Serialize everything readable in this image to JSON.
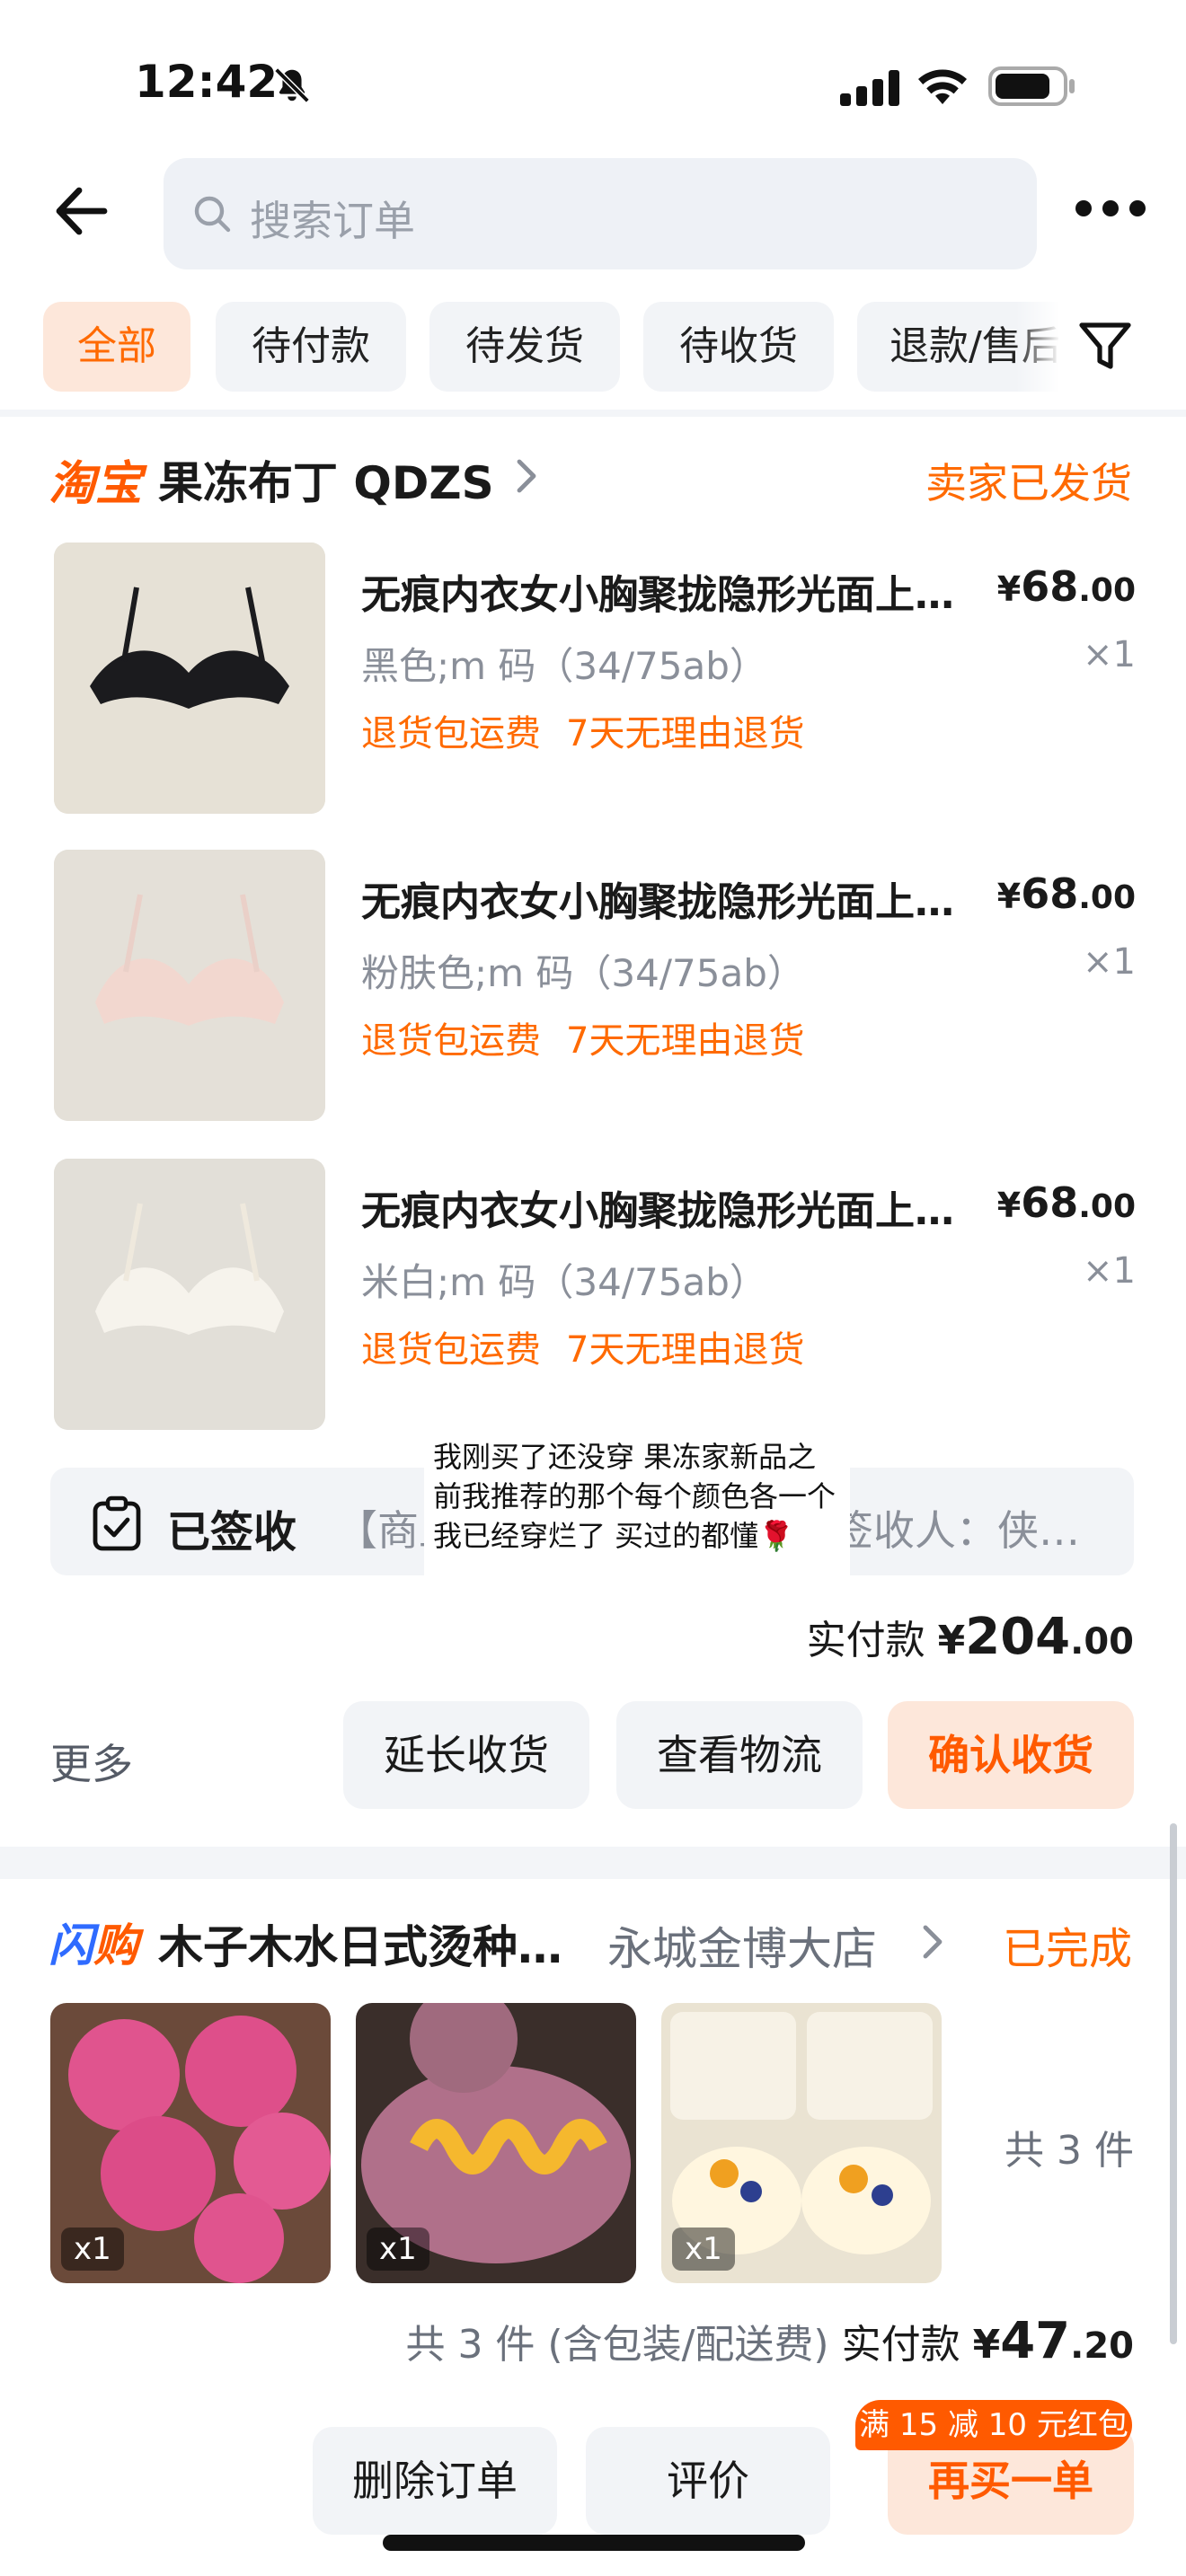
{
  "status_bar": {
    "time": "12:42"
  },
  "header": {
    "search_placeholder": "搜索订单"
  },
  "tabs": [
    {
      "label": "全部",
      "active": true
    },
    {
      "label": "待付款",
      "active": false
    },
    {
      "label": "待发货",
      "active": false
    },
    {
      "label": "待收货",
      "active": false
    },
    {
      "label": "退款/售后",
      "active": false
    }
  ],
  "order1": {
    "platform": "淘宝",
    "shop": "果冻布丁 QDZS",
    "status": "卖家已发货",
    "items": [
      {
        "title": "无痕内衣女小胸聚拢隐形光面上托文胸",
        "price_int": "68",
        "price_dec": ".00",
        "spec": "黑色;m 码（34/75ab）",
        "qty": "×1",
        "tags": [
          "退货包运费",
          "7天无理由退货"
        ],
        "color": "#1b1b1e"
      },
      {
        "title": "无痕内衣女小胸聚拢隐形光面上托文胸",
        "price_int": "68",
        "price_dec": ".00",
        "spec": "粉肤色;m 码（34/75ab）",
        "qty": "×1",
        "tags": [
          "退货包运费",
          "7天无理由退货"
        ],
        "color": "#f2d7cf"
      },
      {
        "title": "无痕内衣女小胸聚拢隐形光面上托文胸",
        "price_int": "68",
        "price_dec": ".00",
        "spec": "米白;m 码（34/75ab）",
        "qty": "×1",
        "tags": [
          "退货包运费",
          "7天无理由退货"
        ],
        "color": "#f4efe6"
      }
    ],
    "logistics_status": "已签收",
    "logistics_detail": "【商丘】您的快件已签收，签收人：侠光（勿找...",
    "note": "我刚买了还没穿 果冻家新品之前我推荐的那个每个颜色各一个我已经穿烂了 买过的都懂🌹",
    "paid_label": "实付款",
    "currency": "¥",
    "paid_int": "204",
    "paid_dec": ".00",
    "more": "更多",
    "buttons": {
      "extend": "延长收货",
      "logistics": "查看物流",
      "confirm": "确认收货"
    }
  },
  "order2": {
    "platform_a": "闪",
    "platform_b": "购",
    "shop": "木子木水日式烫种面包",
    "store": "永城金博大店",
    "status": "已完成",
    "thumbs": [
      {
        "qty": "x1",
        "color": "#e0548e"
      },
      {
        "qty": "x1",
        "color": "#b0708a"
      },
      {
        "qty": "x1",
        "color": "#f2e6c8"
      }
    ],
    "count": "共 3 件",
    "summary_prefix": "共 3 件 (含包装/配送费)",
    "paid_label": "实付款",
    "currency": "¥",
    "paid_int": "47",
    "paid_dec": ".20",
    "promo": "满 15 减 10 元红包",
    "buttons": {
      "delete": "删除订单",
      "review": "评价",
      "rebuy": "再买一单"
    }
  },
  "colors": {
    "accent": "#ff6a00",
    "tab_bg": "#f2f4f7"
  }
}
